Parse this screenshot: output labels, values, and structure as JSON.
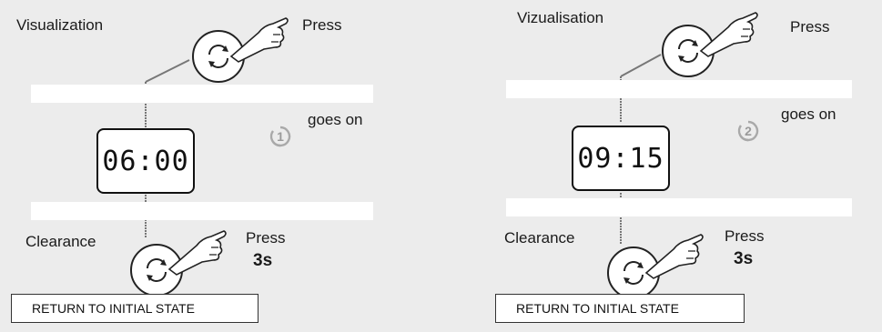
{
  "left": {
    "title": "Visualization",
    "press_top": "Press",
    "goes_on": "goes on",
    "step_number": "1",
    "display": "06:00",
    "clearance": "Clearance",
    "press_bottom": "Press",
    "duration": "3s",
    "return_label": "RETURN TO INITIAL STATE"
  },
  "right": {
    "title": "Vizualisation",
    "press_top": "Press",
    "goes_on": "goes on",
    "step_number": "2",
    "display": "09:15",
    "clearance": "Clearance",
    "press_bottom": "Press",
    "duration": "3s",
    "return_label": "RETURN TO INITIAL STATE"
  },
  "colors": {
    "background": "#ececec",
    "band": "#ffffff",
    "connector": "#777777"
  },
  "icons": {
    "button": "rotate-button-icon",
    "hand": "pointing-hand-icon",
    "step": "circled-number-icon"
  }
}
